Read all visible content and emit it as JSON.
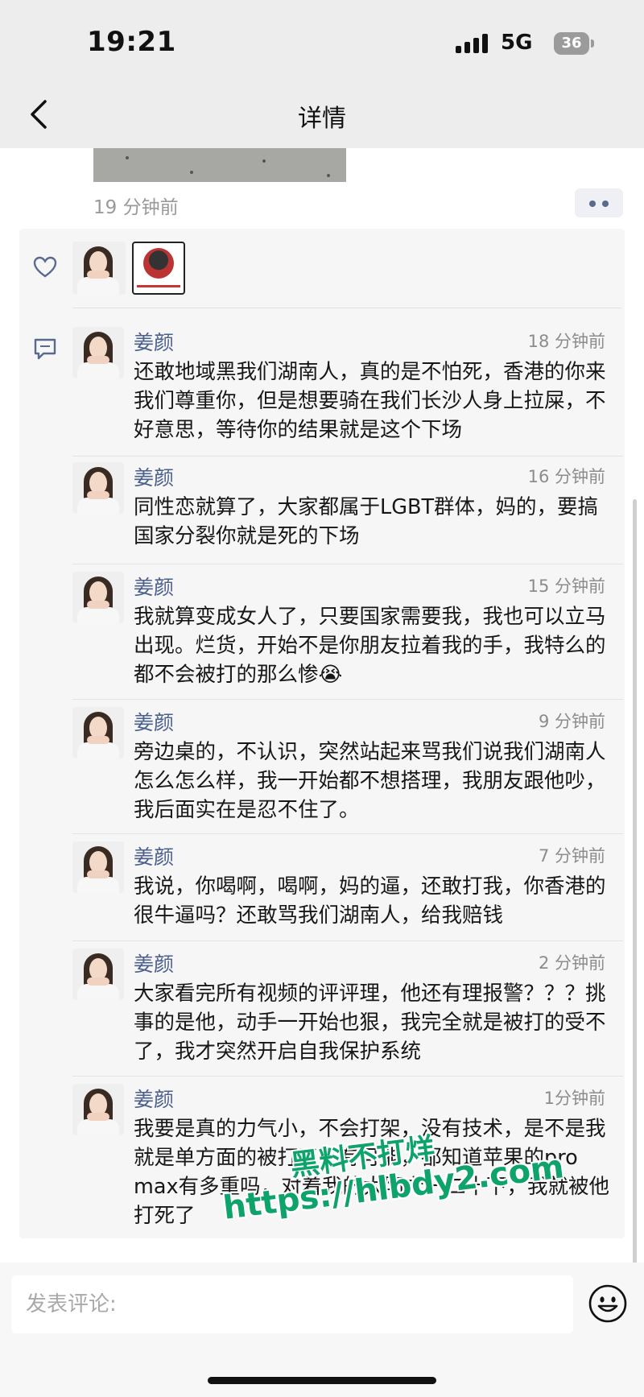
{
  "status_bar": {
    "time": "19:21",
    "network": "5G",
    "battery": "36"
  },
  "nav": {
    "title": "详情"
  },
  "post": {
    "time": "19 分钟前"
  },
  "comments": [
    {
      "name": "姜颜",
      "time": "18 分钟前",
      "text": "还敢地域黑我们湖南人，真的是不怕死，香港的你来我们尊重你，但是想要骑在我们长沙人身上拉屎，不好意思，等待你的结果就是这个下场"
    },
    {
      "name": "姜颜",
      "time": "16 分钟前",
      "text": "同性恋就算了，大家都属于LGBT群体，妈的，要搞国家分裂你就是死的下场"
    },
    {
      "name": "姜颜",
      "time": "15 分钟前",
      "text": "我就算变成女人了，只要国家需要我，我也可以立马出现。烂货，开始不是你朋友拉着我的手，我特么的都不会被打的那么惨😭"
    },
    {
      "name": "姜颜",
      "time": "9 分钟前",
      "text": "旁边桌的，不认识，突然站起来骂我们说我们湖南人怎么怎么样，我一开始都不想搭理，我朋友跟他吵，我后面实在是忍不住了。"
    },
    {
      "name": "姜颜",
      "time": "7 分钟前",
      "text": "我说，你喝啊，喝啊，妈的逼，还敢打我，你香港的很牛逼吗？还敢骂我们湖南人，给我赔钱"
    },
    {
      "name": "姜颜",
      "time": "2 分钟前",
      "text": "大家看完所有视频的评评理，他还有理报警？？？挑事的是他，动手一开始也狠，我完全就是被打的受不了，我才突然开启自我保护系统"
    },
    {
      "name": "姜颜",
      "time": "1分钟前",
      "text": "我要是真的力气小，不会打架，没有技术，是不是我就是单方面的被打了，有可能，都知道苹果的pro max有多重吗，对着我的太阳穴一二十下，我就被他打死了"
    }
  ],
  "input": {
    "placeholder": "发表评论:"
  },
  "watermark": {
    "line1": "黑料不打烊",
    "line2": "https://hlbdy2.com"
  },
  "colors": {
    "link_name": "#4a5f8c",
    "watermark": "#0ea36b",
    "nav_bg": "#ededed"
  }
}
